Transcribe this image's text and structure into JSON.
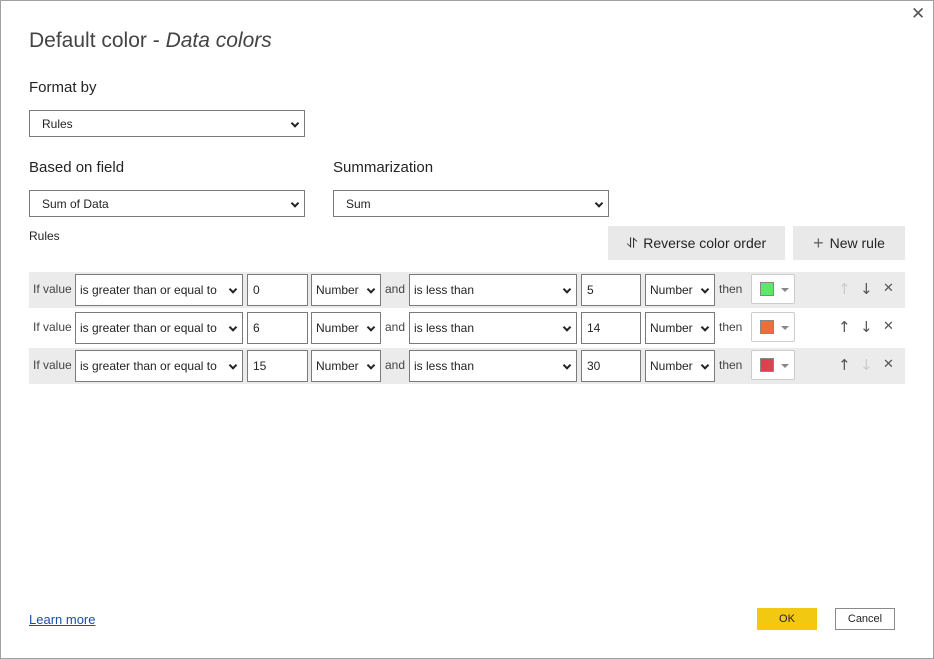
{
  "dialog": {
    "title_main": "Default color - ",
    "title_italic": "Data colors",
    "close_icon": "close-icon"
  },
  "format_by": {
    "label": "Format by",
    "value": "Rules"
  },
  "based_on_field": {
    "label": "Based on field",
    "value": "Sum of Data"
  },
  "summarization": {
    "label": "Summarization",
    "value": "Sum"
  },
  "rules_label": "Rules",
  "buttons": {
    "reverse": "Reverse color order",
    "reverse_icon": "⥯",
    "new_rule": "New rule",
    "new_rule_icon": "+",
    "ok": "OK",
    "cancel": "Cancel"
  },
  "rules": [
    {
      "if": "If value",
      "op1": "is greater than or equal to",
      "v1": "0",
      "t1": "Number",
      "and": "and",
      "op2": "is less than",
      "v2": "5",
      "t2": "Number",
      "then": "then",
      "color": "#5ee86a",
      "up_enabled": false,
      "down_enabled": true
    },
    {
      "if": "If value",
      "op1": "is greater than or equal to",
      "v1": "6",
      "t1": "Number",
      "and": "and",
      "op2": "is less than",
      "v2": "14",
      "t2": "Number",
      "then": "then",
      "color": "#e8703a",
      "up_enabled": true,
      "down_enabled": true
    },
    {
      "if": "If value",
      "op1": "is greater than or equal to",
      "v1": "15",
      "t1": "Number",
      "and": "and",
      "op2": "is less than",
      "v2": "30",
      "t2": "Number",
      "then": "then",
      "color": "#d9434f",
      "up_enabled": true,
      "down_enabled": false
    }
  ],
  "footer": {
    "learn_more": "Learn more"
  }
}
